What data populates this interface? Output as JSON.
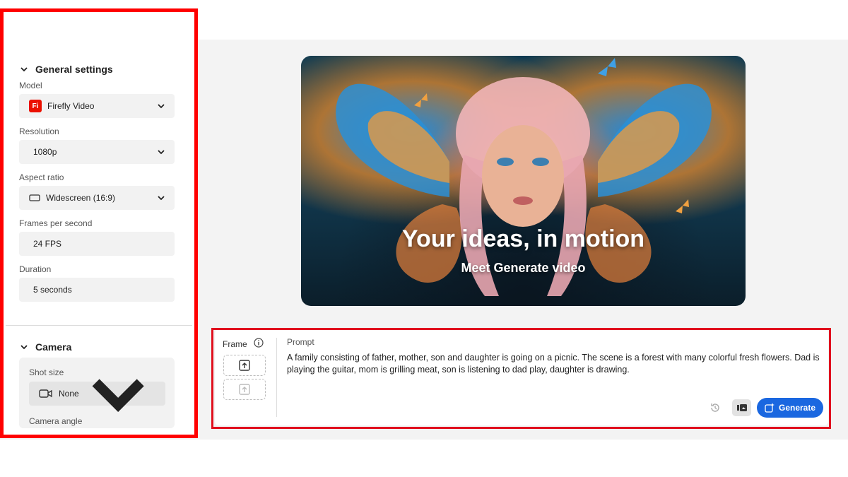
{
  "sidebar": {
    "general_settings": {
      "heading": "General settings",
      "model": {
        "label": "Model",
        "value": "Firefly Video",
        "logo_text": "Fi"
      },
      "resolution": {
        "label": "Resolution",
        "value": "1080p"
      },
      "aspect_ratio": {
        "label": "Aspect ratio",
        "value": "Widescreen (16:9)"
      },
      "fps": {
        "label": "Frames per second",
        "value": "24 FPS"
      },
      "duration": {
        "label": "Duration",
        "value": "5 seconds"
      }
    },
    "camera": {
      "heading": "Camera",
      "shot_size": {
        "label": "Shot size",
        "value": "None"
      },
      "camera_angle": {
        "label": "Camera angle"
      }
    }
  },
  "hero": {
    "title": "Your ideas, in motion",
    "subtitle": "Meet Generate video"
  },
  "prompt_panel": {
    "frame_label": "Frame",
    "prompt_label": "Prompt",
    "prompt_text": "A family consisting of father, mother, son and daughter is going on a picnic. The scene is a forest with many colorful fresh flowers. Dad is playing the guitar, mom is grilling meat, son is listening to dad play, daughter is drawing.",
    "generate_label": "Generate"
  },
  "colors": {
    "accent": "#1a67e0",
    "highlight": "#ff0000",
    "firefly_logo": "#eb1000"
  }
}
